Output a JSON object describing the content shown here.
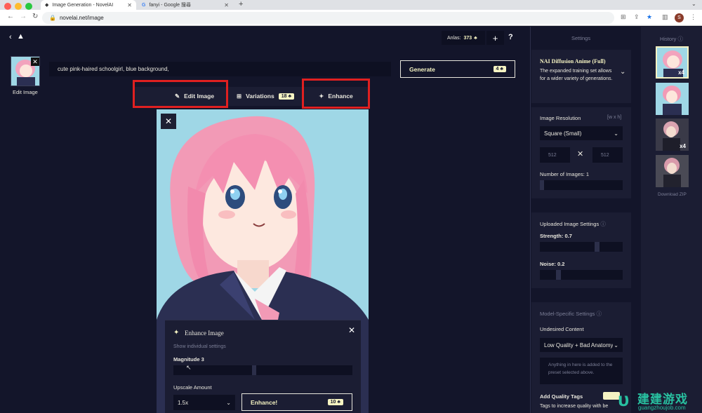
{
  "browser": {
    "tabs": [
      {
        "title": "Image Generation - NovelAI",
        "active": true
      },
      {
        "title": "fanyi - Google 搜尋",
        "active": false
      }
    ],
    "url": "novelai.net/image",
    "profile_initial": "S"
  },
  "header": {
    "anlas_label": "Anlas:",
    "anlas_value": "373",
    "plus": "+",
    "help": "?"
  },
  "left": {
    "edit_image_label": "Edit Image"
  },
  "prompt": {
    "text": "cute pink-haired schoolgirl, blue background,"
  },
  "generate": {
    "label": "Generate",
    "cost": "4"
  },
  "actions": {
    "edit_image": "Edit Image",
    "variations": "Variations",
    "variations_cost": "18",
    "enhance": "Enhance"
  },
  "enhance_panel": {
    "title": "Enhance Image",
    "show_individual": "Show individual settings",
    "magnitude_label": "Magnitude",
    "magnitude_value": "3",
    "upscale_label": "Upscale Amount",
    "upscale_value": "1.5x",
    "enhance_button": "Enhance!",
    "enhance_cost": "10",
    "magnitude_fraction": 0.45
  },
  "settings": {
    "title": "Settings",
    "model": {
      "name": "NAI Diffusion Anime (Full)",
      "description": "The expanded training set allows for a wider variety of generations."
    },
    "resolution": {
      "label": "Image Resolution",
      "hint": "[w x h]",
      "preset": "Square (Small)",
      "width_placeholder": "512",
      "height_placeholder": "512"
    },
    "num_images": {
      "label": "Number of Images:",
      "value": "1"
    },
    "uploaded": {
      "title": "Uploaded Image Settings",
      "strength_label": "Strength:",
      "strength_value": "0.7",
      "noise_label": "Noise:",
      "noise_value": "0.2"
    },
    "model_specific": {
      "title": "Model-Specific Settings",
      "undesired_label": "Undesired Content",
      "undesired_preset": "Low Quality + Bad Anatomy",
      "undesired_placeholder": "Anything in here is added to the preset selected above.",
      "quality_tags_label": "Add Quality Tags",
      "quality_tags_desc": "Tags to increase quality with be"
    }
  },
  "history": {
    "title": "History",
    "thumbs": [
      {
        "badge": "x4",
        "selected": true
      },
      {
        "badge": "",
        "selected": false
      },
      {
        "badge": "x4",
        "selected": false
      },
      {
        "badge": "",
        "selected": false
      }
    ],
    "download": "Download ZIP"
  },
  "watermark": {
    "title": "建建游戏",
    "url": "guangzhoujob.com"
  },
  "colors": {
    "bg": "#13152a",
    "panel": "#1b1d33",
    "accent": "#f5f3c2",
    "highlight": "#e02020",
    "image_bg": "#9fd7e6"
  }
}
